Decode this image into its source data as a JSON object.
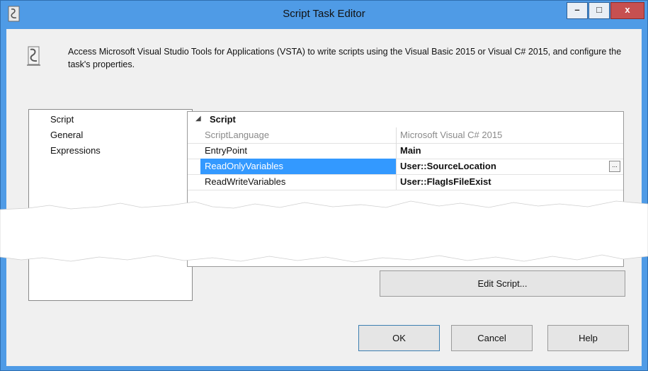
{
  "window": {
    "title": "Script Task Editor",
    "colors": {
      "titlebar": "#4f9be6",
      "close": "#c75050",
      "selection": "#3399ff"
    }
  },
  "caption_buttons": {
    "minimize_label": "–",
    "maximize_label": "□",
    "close_label": "x"
  },
  "header": {
    "description": "Access Microsoft Visual Studio Tools for Applications (VSTA) to write scripts using the Visual Basic 2015 or Visual C# 2015, and configure the task's properties."
  },
  "nav": {
    "items": [
      {
        "label": "Script"
      },
      {
        "label": "General"
      },
      {
        "label": "Expressions"
      }
    ]
  },
  "properties": {
    "category": "Script",
    "expander": "◢",
    "rows": [
      {
        "name": "ScriptLanguage",
        "value": "Microsoft Visual C# 2015"
      },
      {
        "name": "EntryPoint",
        "value": "Main"
      },
      {
        "name": "ReadOnlyVariables",
        "value": "User::SourceLocation",
        "button": "..."
      },
      {
        "name": "ReadWriteVariables",
        "value": "User::FlagIsFileExist"
      }
    ]
  },
  "buttons": {
    "edit_script": "Edit Script...",
    "ok": "OK",
    "cancel": "Cancel",
    "help": "Help"
  }
}
